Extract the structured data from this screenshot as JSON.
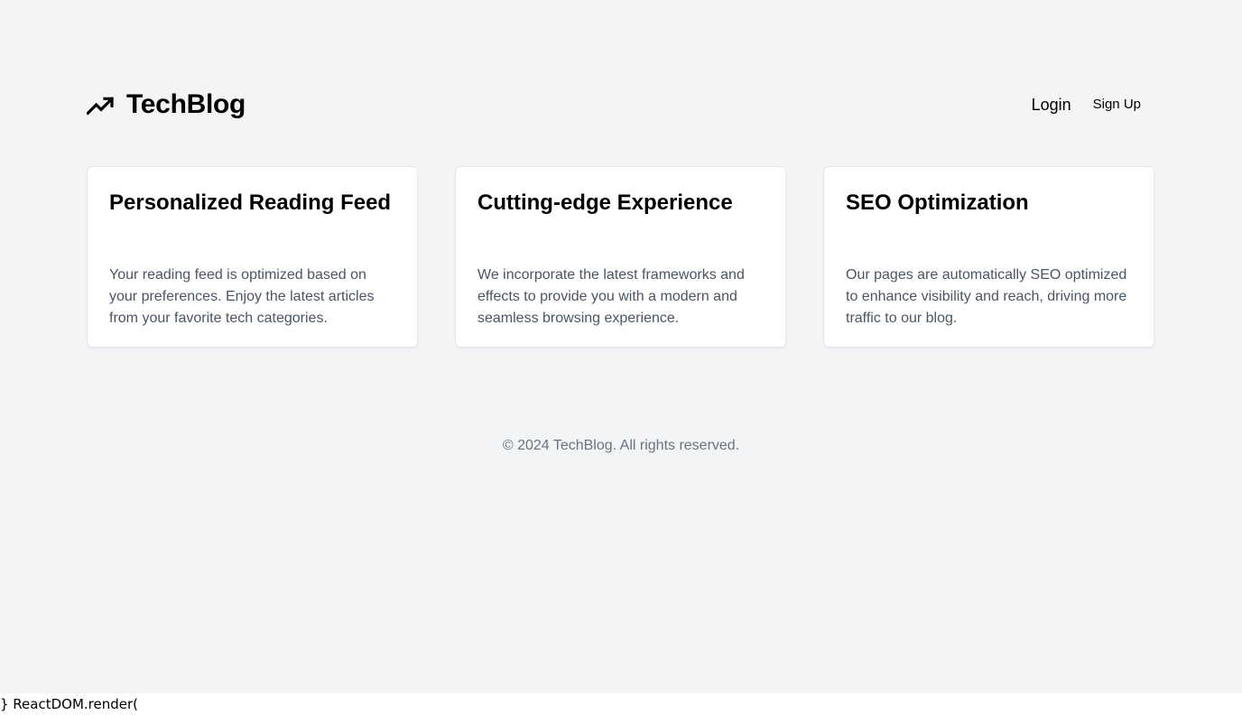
{
  "header": {
    "brand_name": "TechBlog",
    "brand_icon": "trending-up-icon",
    "nav": {
      "login_label": "Login",
      "signup_label": "Sign Up"
    }
  },
  "features": [
    {
      "title": "Personalized Reading Feed",
      "description": "Your reading feed is optimized based on your preferences. Enjoy the latest articles from your favorite tech categories."
    },
    {
      "title": "Cutting-edge Experience",
      "description": "We incorporate the latest frameworks and effects to provide you with a modern and seamless browsing experience."
    },
    {
      "title": "SEO Optimization",
      "description": "Our pages are automatically SEO optimized to enhance visibility and reach, driving more traffic to our blog."
    }
  ],
  "footer": {
    "copyright": "© 2024 TechBlog. All rights reserved."
  },
  "raw_text": {
    "code_fragment": "} ReactDOM.render("
  },
  "colors": {
    "page_background": "#f3f4f6",
    "card_background": "#ffffff",
    "body_text": "#4b5563",
    "footer_text": "#6b7280"
  }
}
